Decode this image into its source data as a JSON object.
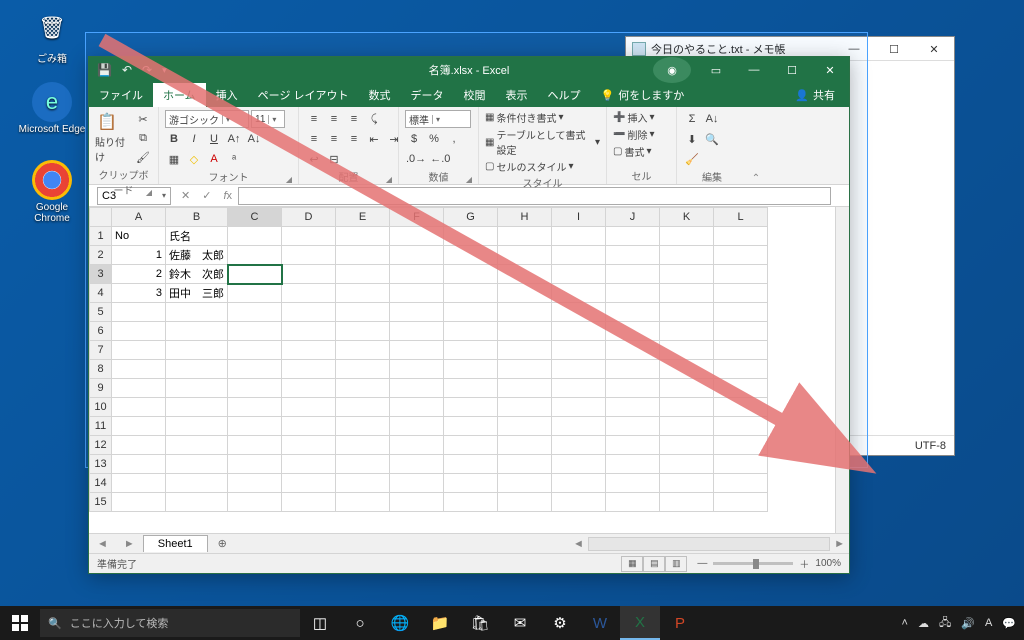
{
  "desktop": {
    "icons": [
      {
        "label": "ごみ箱",
        "glyph": "🗑",
        "bg": "transparent"
      },
      {
        "label": "Microsoft Edge",
        "glyph": "e",
        "bg": "#1b6cc1"
      },
      {
        "label": "Google Chrome",
        "glyph": "●",
        "bg": "#fff"
      }
    ]
  },
  "notepad": {
    "title": "今日のやること.txt - メモ帳",
    "encoding": "UTF-8"
  },
  "excel": {
    "title": "名簿.xlsx - Excel",
    "tabs": [
      "ファイル",
      "ホーム",
      "挿入",
      "ページ レイアウト",
      "数式",
      "データ",
      "校閲",
      "表示",
      "ヘルプ"
    ],
    "active_tab": 1,
    "tell_me": "何をしますか",
    "share": "共有",
    "ribbon": {
      "clipboard": {
        "label": "クリップボード",
        "paste": "貼り付け"
      },
      "font": {
        "label": "フォント",
        "name": "游ゴシック",
        "size": "11"
      },
      "align": {
        "label": "配置"
      },
      "number": {
        "label": "数値",
        "format": "標準"
      },
      "styles": {
        "label": "スタイル",
        "cond": "条件付き書式",
        "tbl": "テーブルとして書式設定",
        "cell": "セルのスタイル"
      },
      "cells": {
        "label": "セル",
        "ins": "挿入",
        "del": "削除",
        "fmt": "書式"
      },
      "editing": {
        "label": "編集"
      }
    },
    "namebox": "C3",
    "columns": [
      "A",
      "B",
      "C",
      "D",
      "E",
      "F",
      "G",
      "H",
      "I",
      "J",
      "K",
      "L"
    ],
    "rows": 15,
    "data": {
      "1": {
        "A": "No",
        "B": "氏名"
      },
      "2": {
        "A": "1",
        "B": "佐藤　太郎"
      },
      "3": {
        "A": "2",
        "B": "鈴木　次郎"
      },
      "4": {
        "A": "3",
        "B": "田中　三郎"
      }
    },
    "selected": {
      "row": 3,
      "col": "C"
    },
    "sheet_tab": "Sheet1",
    "status": "準備完了",
    "zoom": "100%"
  },
  "taskbar": {
    "search_placeholder": "ここに入力して検索"
  }
}
